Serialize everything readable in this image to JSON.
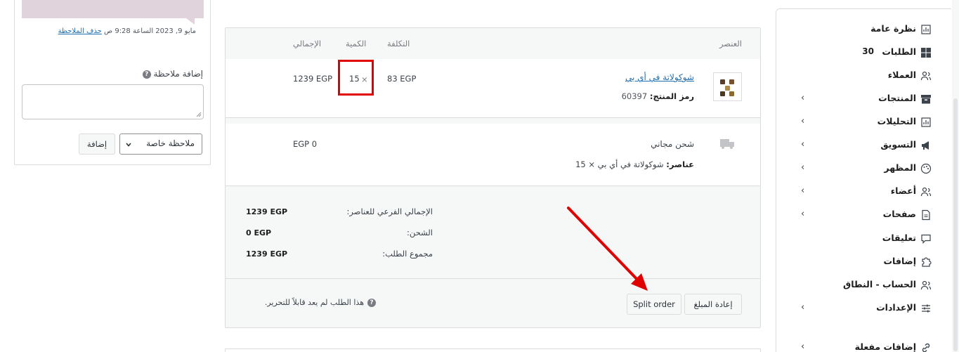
{
  "sidebar": {
    "items": [
      {
        "label": "نظرة عامة",
        "icon": "chart-icon",
        "chevron": false
      },
      {
        "label": "الطلبات",
        "icon": "grid-icon",
        "chevron": false,
        "count": "30"
      },
      {
        "label": "العملاء",
        "icon": "users-icon",
        "chevron": false
      },
      {
        "label": "المنتجات",
        "icon": "archive-icon",
        "chevron": true
      },
      {
        "label": "التحليلات",
        "icon": "chart-icon",
        "chevron": true
      },
      {
        "label": "التسويق",
        "icon": "megaphone-icon",
        "chevron": true
      },
      {
        "label": "المظهر",
        "icon": "palette-icon",
        "chevron": true
      },
      {
        "label": "أعضاء",
        "icon": "users-icon",
        "chevron": true
      },
      {
        "label": "صفحات",
        "icon": "page-icon",
        "chevron": true
      },
      {
        "label": "تعليقات",
        "icon": "comment-icon",
        "chevron": false
      },
      {
        "label": "إضافات",
        "icon": "puzzle-icon",
        "chevron": false
      },
      {
        "label": "الحساب - النطاق",
        "icon": "users-icon",
        "chevron": false
      },
      {
        "label": "الإعدادات",
        "icon": "sliders-icon",
        "chevron": true
      },
      {
        "label": "إضافات مفعلة",
        "icon": "link-icon",
        "chevron": true
      }
    ]
  },
  "order": {
    "header": {
      "item": "العنصر",
      "cost": "التكلفة",
      "qty": "الكمية",
      "total": "الإجمالي"
    },
    "line_item": {
      "name": "شوكولاتة في أي بي",
      "sku_label": "رمز المنتج:",
      "sku": "60397",
      "cost": "83 EGP",
      "qty_sign": "×",
      "qty": "15",
      "total": "1239 EGP"
    },
    "shipping": {
      "title": "شحن مجاني",
      "items_label": "عناصر:",
      "items": "شوكولاتة في أي بي × 15",
      "total": "EGP 0"
    },
    "totals": [
      {
        "label": "الإجمالي الفرعي للعناصر:",
        "value": "1239 EGP"
      },
      {
        "label": "الشحن:",
        "value": "0 EGP"
      },
      {
        "label": "مجموع الطلب:",
        "value": "1239 EGP"
      }
    ],
    "actions": {
      "refund": "إعادة المبلغ",
      "split": "Split order",
      "notice": "هذا الطلب لم يعد قابلاً للتحرير."
    }
  },
  "notes": {
    "meta_date": "مايو 9, 2023 الساعة 9:28 ص",
    "delete_link": "حذف الملاحظة",
    "add_label": "إضافة ملاحظة",
    "type_selected": "ملاحظة خاصة",
    "add_button": "إضافة"
  },
  "colors": {
    "accent": "#2271b1",
    "highlight": "#e00000",
    "note_bg": "#e1d3dc"
  }
}
